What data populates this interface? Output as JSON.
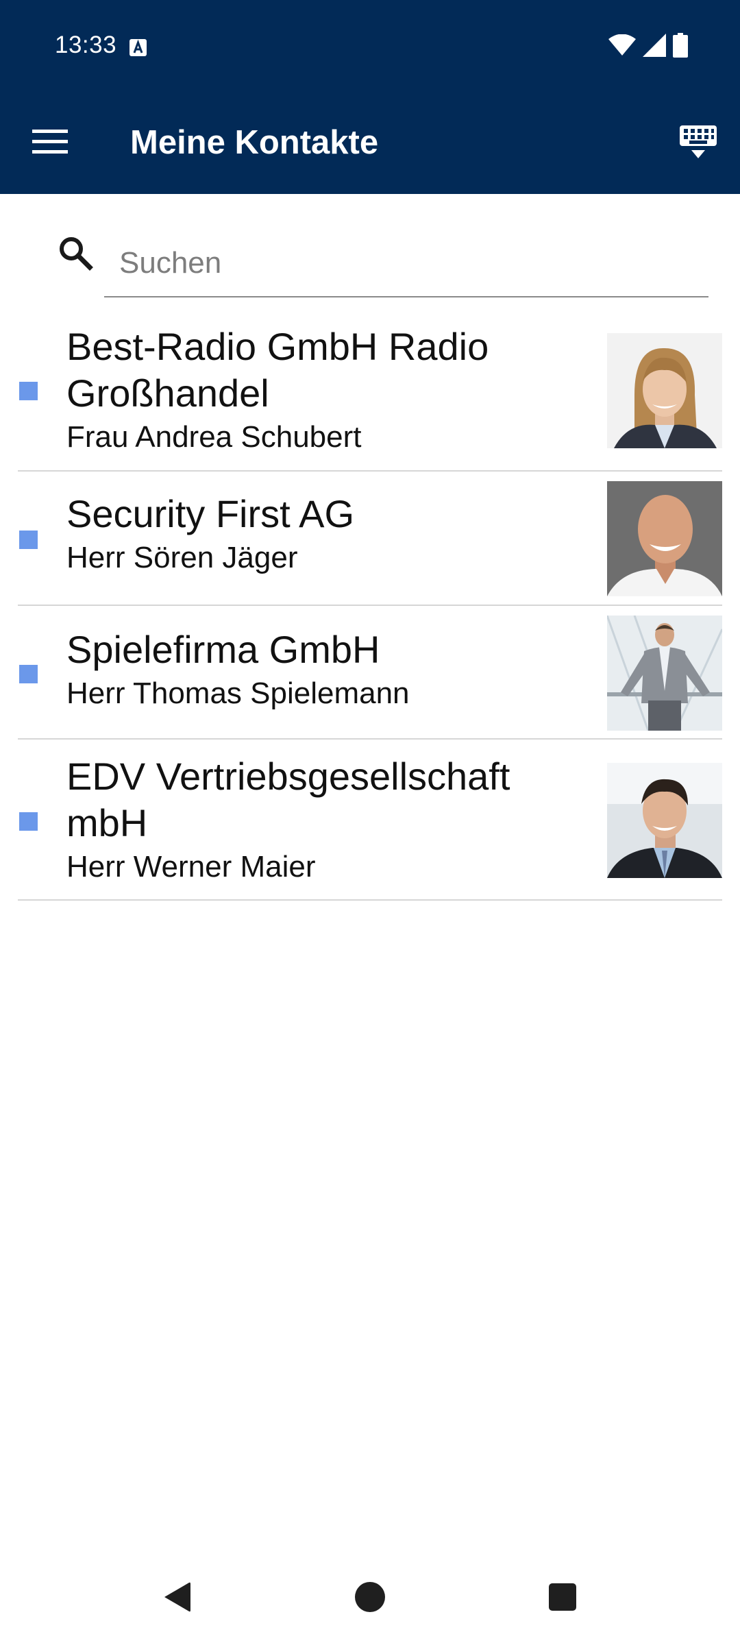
{
  "status_bar": {
    "time": "13:33"
  },
  "app_bar": {
    "title": "Meine Kontakte"
  },
  "search": {
    "placeholder": "Suchen",
    "value": ""
  },
  "contacts": [
    {
      "company_line1": "Best-Radio GmbH Radio",
      "company_line2": "Großhandel",
      "person": "Frau Andrea Schubert"
    },
    {
      "company_line1": "Security First AG",
      "person": "Herr Sören Jäger"
    },
    {
      "company_line1": "Spielefirma GmbH",
      "person": "Herr Thomas Spielemann"
    },
    {
      "company_line1": "EDV Vertriebsgesellschaft",
      "company_line2": "mbH",
      "person": "Herr Werner Maier"
    }
  ],
  "colors": {
    "app_bar_background": "#022a57",
    "marker_accent": "#6b98ea",
    "divider": "#d6d6d6"
  },
  "icons": {
    "status": [
      "a-notification-icon",
      "wifi-icon",
      "signal-icon",
      "battery-icon"
    ],
    "app_bar": [
      "menu-icon",
      "keyboard-hide-icon"
    ],
    "navigation": [
      "back-icon",
      "home-icon",
      "recents-icon"
    ]
  }
}
